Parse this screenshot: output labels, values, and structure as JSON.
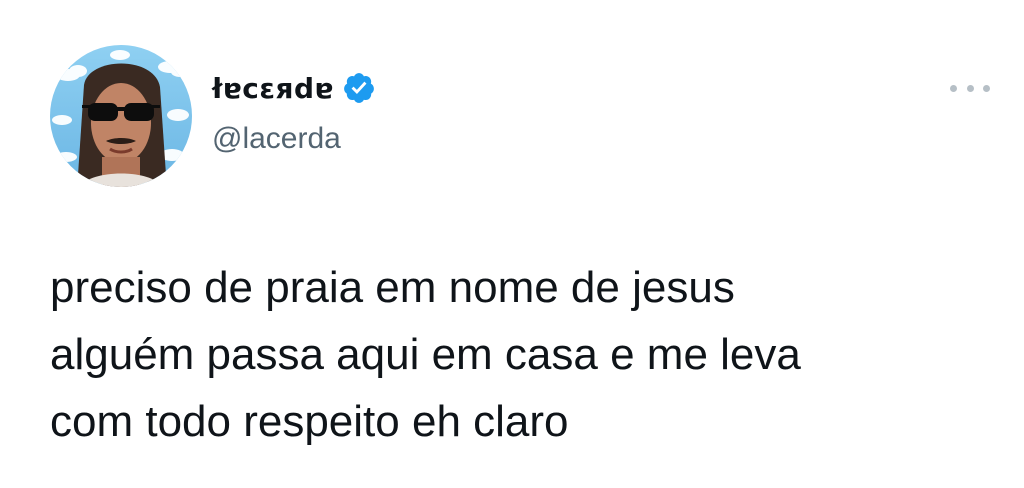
{
  "tweet": {
    "author": {
      "display_name": "łɐcɛяdɐ",
      "handle": "@lacerda",
      "verified": true,
      "avatar_icon": "profile-photo-sunglasses"
    },
    "more_icon": "ellipsis-icon",
    "text_lines": [
      "preciso de praia em nome de jesus",
      "alguém passa aqui em casa e me leva",
      "com todo respeito eh claro"
    ]
  },
  "colors": {
    "text": "#0f1419",
    "secondary": "#536471",
    "verified_blue": "#1d9bf0",
    "avatar_sky": "#7ec3ea"
  }
}
